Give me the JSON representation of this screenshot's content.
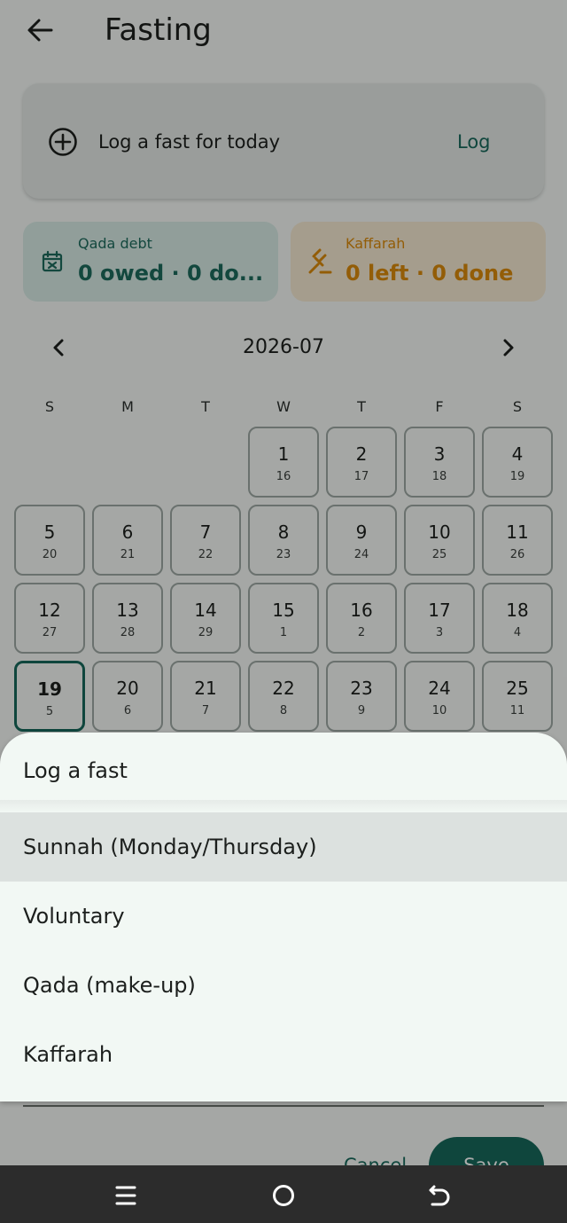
{
  "header": {
    "title": "Fasting",
    "back_icon": "arrow-left-icon"
  },
  "log_card": {
    "text": "Log a fast for today",
    "action": "Log",
    "icon": "plus-circle-icon"
  },
  "stats": {
    "qada": {
      "label": "Qada debt",
      "value": "0 owed · 0 do...",
      "icon": "calendar-x-icon",
      "color": "#1d6a5c"
    },
    "kaffarah": {
      "label": "Kaffarah",
      "value": "0 left · 0 done",
      "icon": "gavel-icon",
      "color": "#d98a0b"
    }
  },
  "calendar": {
    "month": "2026-07",
    "weekdays": [
      "S",
      "M",
      "T",
      "W",
      "T",
      "F",
      "S"
    ],
    "days": [
      {
        "g": "1",
        "h": "16"
      },
      {
        "g": "2",
        "h": "17"
      },
      {
        "g": "3",
        "h": "18"
      },
      {
        "g": "4",
        "h": "19"
      },
      {
        "g": "5",
        "h": "20"
      },
      {
        "g": "6",
        "h": "21"
      },
      {
        "g": "7",
        "h": "22"
      },
      {
        "g": "8",
        "h": "23"
      },
      {
        "g": "9",
        "h": "24"
      },
      {
        "g": "10",
        "h": "25"
      },
      {
        "g": "11",
        "h": "26"
      },
      {
        "g": "12",
        "h": "27"
      },
      {
        "g": "13",
        "h": "28"
      },
      {
        "g": "14",
        "h": "29"
      },
      {
        "g": "15",
        "h": "1"
      },
      {
        "g": "16",
        "h": "2"
      },
      {
        "g": "17",
        "h": "3"
      },
      {
        "g": "18",
        "h": "4"
      },
      {
        "g": "19",
        "h": "5"
      },
      {
        "g": "20",
        "h": "6"
      },
      {
        "g": "21",
        "h": "7"
      },
      {
        "g": "22",
        "h": "8"
      },
      {
        "g": "23",
        "h": "9"
      },
      {
        "g": "24",
        "h": "10"
      },
      {
        "g": "25",
        "h": "11"
      }
    ],
    "today": "19"
  },
  "dialog_buttons": {
    "cancel": "Cancel",
    "save": "Save"
  },
  "sheet": {
    "title": "Log a fast",
    "options": [
      {
        "label": "Sunnah (Monday/Thursday)",
        "selected": true
      },
      {
        "label": "Voluntary",
        "selected": false
      },
      {
        "label": "Qada (make-up)",
        "selected": false
      },
      {
        "label": "Kaffarah",
        "selected": false
      }
    ]
  },
  "navbar": {
    "recents_icon": "recents-icon",
    "home_icon": "home-circle-icon",
    "back_icon": "back-gesture-icon"
  }
}
